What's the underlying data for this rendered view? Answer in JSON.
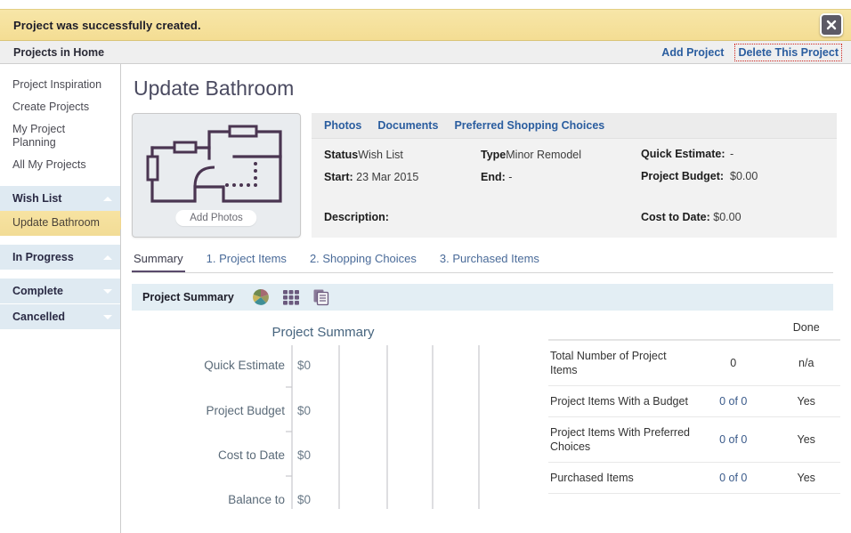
{
  "notice": {
    "message": "Project was successfully created.",
    "close_icon": "close-icon",
    "bg_color": "#f4dd93"
  },
  "subbar": {
    "title": "Projects in Home",
    "add_project": "Add Project",
    "delete_project": "Delete This Project",
    "link_color": "#2a5d9f",
    "focus_outline_color": "#d0241e"
  },
  "sidebar": {
    "links": [
      {
        "label": "Project Inspiration"
      },
      {
        "label": "Create Projects"
      },
      {
        "label": "My Project Planning"
      },
      {
        "label": "All My Projects"
      }
    ],
    "groups": [
      {
        "label": "Wish List",
        "caret": "chevron-up-icon"
      },
      {
        "label": "In Progress",
        "caret": "chevron-up-icon"
      },
      {
        "label": "Complete",
        "caret": "chevron-down-icon"
      },
      {
        "label": "Cancelled",
        "caret": "chevron-down-icon"
      }
    ],
    "active_child": "Update Bathroom",
    "active_bg": "#f2dc96",
    "group_bg": "#dfeaf2"
  },
  "main": {
    "page_title": "Update Bathroom",
    "thumbnail": {
      "add_photos_label": "Add Photos",
      "icon": "floorplan-icon"
    },
    "info_tabs": [
      {
        "label": "Photos"
      },
      {
        "label": "Documents"
      },
      {
        "label": "Preferred Shopping Choices"
      }
    ],
    "info": {
      "status_label": "Status",
      "status_value": "Wish List",
      "start_label": "Start:",
      "start_value": "23 Mar 2015",
      "type_label": "Type",
      "type_value": "Minor Remodel",
      "end_label": "End:",
      "end_value": "-",
      "quick_estimate_label": "Quick Estimate:",
      "quick_estimate_value": "-",
      "project_budget_label": "Project Budget:",
      "project_budget_value": "$0.00",
      "description_label": "Description:",
      "cost_to_date_label": "Cost to Date:",
      "cost_to_date_value": "$0.00"
    },
    "tabs": [
      {
        "label": "Summary",
        "active": true
      },
      {
        "label": "1. Project Items",
        "active": false
      },
      {
        "label": "2. Shopping Choices",
        "active": false
      },
      {
        "label": "3. Purchased Items",
        "active": false
      }
    ],
    "panel": {
      "title": "Project Summary",
      "icons": [
        {
          "name": "pie-chart-icon"
        },
        {
          "name": "grid-view-icon"
        },
        {
          "name": "documents-icon"
        }
      ],
      "bg_color": "#e3eef4"
    },
    "table": {
      "columns": [
        "",
        "",
        "Done"
      ],
      "rows": [
        {
          "label": "Total Number of Project Items",
          "value": "0",
          "done": "n/a",
          "link": false
        },
        {
          "label": "Project Items With a Budget",
          "value": "0 of 0",
          "done": "Yes",
          "link": true
        },
        {
          "label": "Project Items With Preferred Choices",
          "value": "0 of 0",
          "done": "Yes",
          "link": true
        },
        {
          "label": "Purchased Items",
          "value": "0 of 0",
          "done": "Yes",
          "link": true
        }
      ]
    }
  },
  "chart_data": {
    "type": "bar",
    "orientation": "horizontal",
    "title": "Project Summary",
    "categories": [
      "Quick Estimate",
      "Project Budget",
      "Cost to Date",
      "Balance to"
    ],
    "values": [
      0,
      0,
      0,
      0
    ],
    "value_labels": [
      "$0",
      "$0",
      "$0",
      "$0"
    ],
    "xlabel": "",
    "ylabel": "",
    "xlim": [
      0,
      5
    ],
    "grid": true,
    "gridlines": 5,
    "legend": "none",
    "title_color": "#46647e",
    "label_color": "#5a6a78"
  }
}
